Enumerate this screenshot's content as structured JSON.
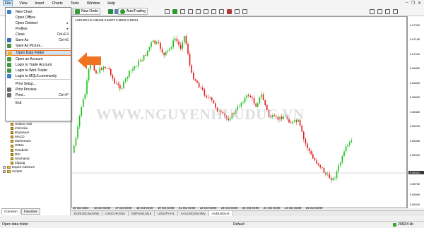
{
  "menubar": {
    "items": [
      "File",
      "View",
      "Insert",
      "Charts",
      "Tools",
      "Window",
      "Help"
    ]
  },
  "toolbar": {
    "new_order": "New Order",
    "autotrading": "AutoTrading"
  },
  "file_menu": {
    "items": [
      {
        "label": "New Chart",
        "shortcut": "",
        "icon": "new-chart-icon",
        "color": "#3a7fd0"
      },
      {
        "label": "Open Offline",
        "shortcut": "",
        "icon": "",
        "color": ""
      },
      {
        "label": "Open Deleted",
        "shortcut": "▸",
        "icon": "",
        "color": ""
      },
      {
        "label": "Profiles",
        "shortcut": "▸",
        "icon": "",
        "color": ""
      },
      {
        "label": "Close",
        "shortcut": "Ctrl+F4",
        "icon": "",
        "color": ""
      },
      {
        "label": "Save As",
        "shortcut": "Ctrl+S",
        "icon": "save-icon",
        "color": "#3a6fb0"
      },
      {
        "label": "Save As Picture...",
        "shortcut": "",
        "icon": "picture-icon",
        "color": "#4a8f3a"
      },
      {
        "label": "Open Data Folder",
        "shortcut": "",
        "icon": "folder-icon",
        "color": "#e6b030"
      },
      {
        "label": "Open an Account",
        "shortcut": "",
        "icon": "account-icon",
        "color": "#3a9a3a"
      },
      {
        "label": "Login to Trade Account",
        "shortcut": "",
        "icon": "login-icon",
        "color": "#3a9a3a"
      },
      {
        "label": "Login to Web Trader",
        "shortcut": "",
        "icon": "web-trader-icon",
        "color": "#3a9a3a"
      },
      {
        "label": "Login to MQL5.community",
        "shortcut": "",
        "icon": "mql5-icon",
        "color": "#3a7fd0"
      },
      {
        "label": "Print Setup...",
        "shortcut": "",
        "icon": "",
        "color": ""
      },
      {
        "label": "Print Preview",
        "shortcut": "",
        "icon": "print-preview-icon",
        "color": "#6a6a6a"
      },
      {
        "label": "Print...",
        "shortcut": "Ctrl+P",
        "icon": "print-icon",
        "color": "#6a6a6a"
      },
      {
        "label": "Exit",
        "shortcut": "",
        "icon": "",
        "color": ""
      }
    ],
    "highlighted_index": 7
  },
  "navigator": {
    "indicators": [
      "Heiken Ashi",
      "Ichimoku",
      "iExposure",
      "MACD",
      "Momentum",
      "OsMA",
      "Parabolic",
      "RSI",
      "Stochastic",
      "ZigZag"
    ],
    "folders": [
      "Expert Advisors",
      "Scripts"
    ],
    "tabs": [
      "Common",
      "Favorites"
    ]
  },
  "chart": {
    "title": "AUDUSD,H1  0.66316  0.66372  0.66291  0.66321",
    "watermark": "WWW.NGUYENHUUDUC.VN",
    "bull_color": "#19c219",
    "bear_color": "#e01818",
    "current_price": "0.66321",
    "price_labels": [
      "0.67320",
      "0.67165",
      "0.67010",
      "0.66850",
      "0.66695",
      "0.66535",
      "0.66380",
      "0.66225",
      "0.66065",
      "0.65910",
      "0.65750",
      "0.65595",
      "0.65440"
    ],
    "time_labels": [
      "18 Oct 2024",
      "18 Oct 03:00",
      "17 Oct 03:00",
      "18 Oct 03:00",
      "19 Oct 03:00",
      "21 Oct 03:00",
      "22 Oct 03:00",
      "23 Oct 03:00",
      "23 Oct 03:00",
      "24 Oct 03:00",
      "24 Oct 03:00",
      "25 Oct 03:00"
    ]
  },
  "chart_tabs": [
    "EURUSD,Monthly",
    "USDCHF,M15",
    "GBPUSD,M15",
    "USDJPY,H1",
    "XAUUSD,Monthly",
    "AUDUSD,H1"
  ],
  "active_chart_tab": 5,
  "status": {
    "left": "Open data folder",
    "profile": "Default",
    "traffic": "2082/4 kb"
  }
}
